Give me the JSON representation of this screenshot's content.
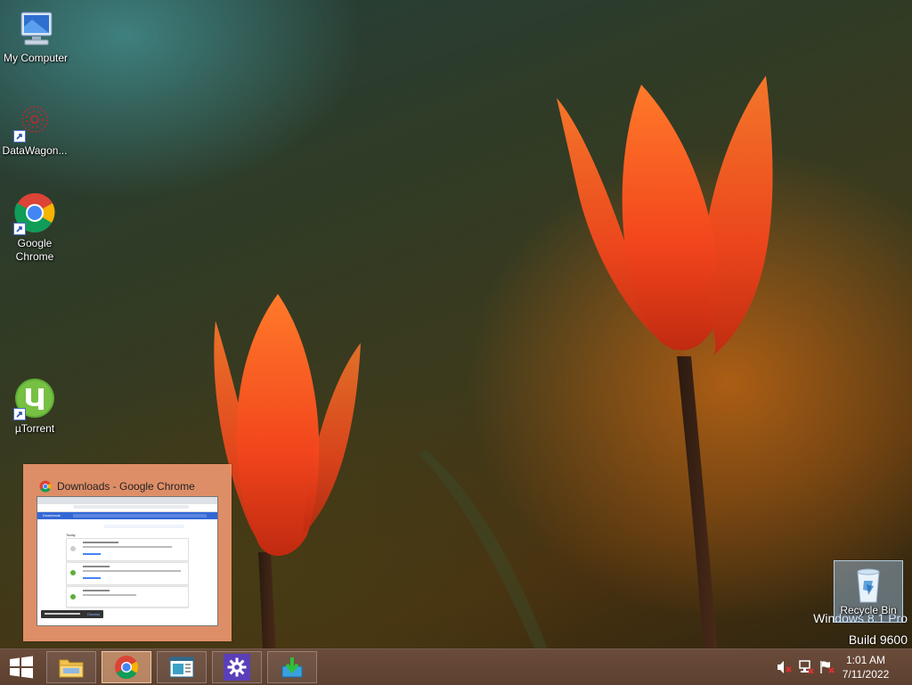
{
  "desktop": {
    "icons": [
      {
        "label": "My Computer",
        "icon": "computer-icon"
      },
      {
        "label": "DataWagon...",
        "icon": "datawagon-icon"
      },
      {
        "label": "Google Chrome",
        "icon": "chrome-icon"
      },
      {
        "label": "µTorrent",
        "icon": "utorrent-icon"
      }
    ],
    "recycle_bin": {
      "label": "Recycle Bin",
      "icon": "recycle-bin-icon"
    },
    "watermark": {
      "line1": "Windows 8.1 Pro",
      "line2": "Build 9600"
    }
  },
  "preview": {
    "title": "Downloads - Google Chrome",
    "thumbnail": {
      "sidebar_label": "Downloads",
      "section_label": "Today",
      "toast_label": "Dismiss"
    }
  },
  "taskbar": {
    "buttons": [
      {
        "name": "file-explorer",
        "icon": "folder-icon",
        "active": false
      },
      {
        "name": "google-chrome",
        "icon": "chrome-icon",
        "active": true
      },
      {
        "name": "app-window",
        "icon": "window-icon",
        "active": false
      },
      {
        "name": "settings",
        "icon": "gear-icon",
        "active": false
      },
      {
        "name": "installer",
        "icon": "download-arrow-icon",
        "active": false
      }
    ],
    "tray": {
      "icons": [
        "speaker-muted-icon",
        "network-icon",
        "action-center-flag-icon"
      ]
    },
    "clock": {
      "time": "1:01 AM",
      "date": "7/11/2022"
    }
  },
  "colors": {
    "accent": "#e8946a",
    "taskbar": "#5f4232"
  }
}
